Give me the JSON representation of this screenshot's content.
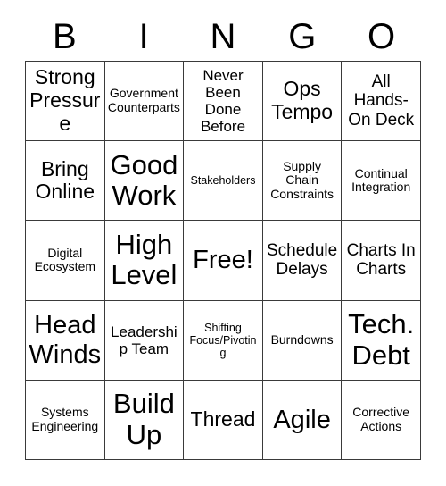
{
  "card": {
    "header_letters": [
      "B",
      "I",
      "N",
      "G",
      "O"
    ],
    "free_space_label": "Free!",
    "columns": 5,
    "rows": 5,
    "colors": {
      "background": "#ffffff",
      "border": "#3a3a3a",
      "text": "#000000"
    },
    "cells": [
      {
        "text": "Strong Pressure",
        "size": "fs-lg"
      },
      {
        "text": "Government Counterparts",
        "size": "fs-xs"
      },
      {
        "text": "Never Been Done Before",
        "size": "fs-sm"
      },
      {
        "text": "Ops Tempo",
        "size": "fs-lg"
      },
      {
        "text": "All Hands-On Deck",
        "size": "fs-md"
      },
      {
        "text": "Bring Online",
        "size": "fs-lg"
      },
      {
        "text": "Good Work",
        "size": "fs-xxl"
      },
      {
        "text": "Stakeholders",
        "size": "fs-xxs"
      },
      {
        "text": "Supply Chain Constraints",
        "size": "fs-xs"
      },
      {
        "text": "Continual Integration",
        "size": "fs-xs"
      },
      {
        "text": "Digital Ecosystem",
        "size": "fs-xs"
      },
      {
        "text": "High Level",
        "size": "fs-xxl"
      },
      {
        "text": "Free!",
        "size": "fs-xl"
      },
      {
        "text": "Schedule Delays",
        "size": "fs-md"
      },
      {
        "text": "Charts In Charts",
        "size": "fs-md"
      },
      {
        "text": "Head Winds",
        "size": "fs-xl"
      },
      {
        "text": "Leadership Team",
        "size": "fs-sm"
      },
      {
        "text": "Shifting Focus/Pivoting",
        "size": "fs-xxs"
      },
      {
        "text": "Burndowns",
        "size": "fs-xs"
      },
      {
        "text": "Tech. Debt",
        "size": "fs-xxl"
      },
      {
        "text": "Systems Engineering",
        "size": "fs-xs"
      },
      {
        "text": "Build Up",
        "size": "fs-xxl"
      },
      {
        "text": "Thread",
        "size": "fs-lg"
      },
      {
        "text": "Agile",
        "size": "fs-xl"
      },
      {
        "text": "Corrective Actions",
        "size": "fs-xs"
      }
    ]
  }
}
